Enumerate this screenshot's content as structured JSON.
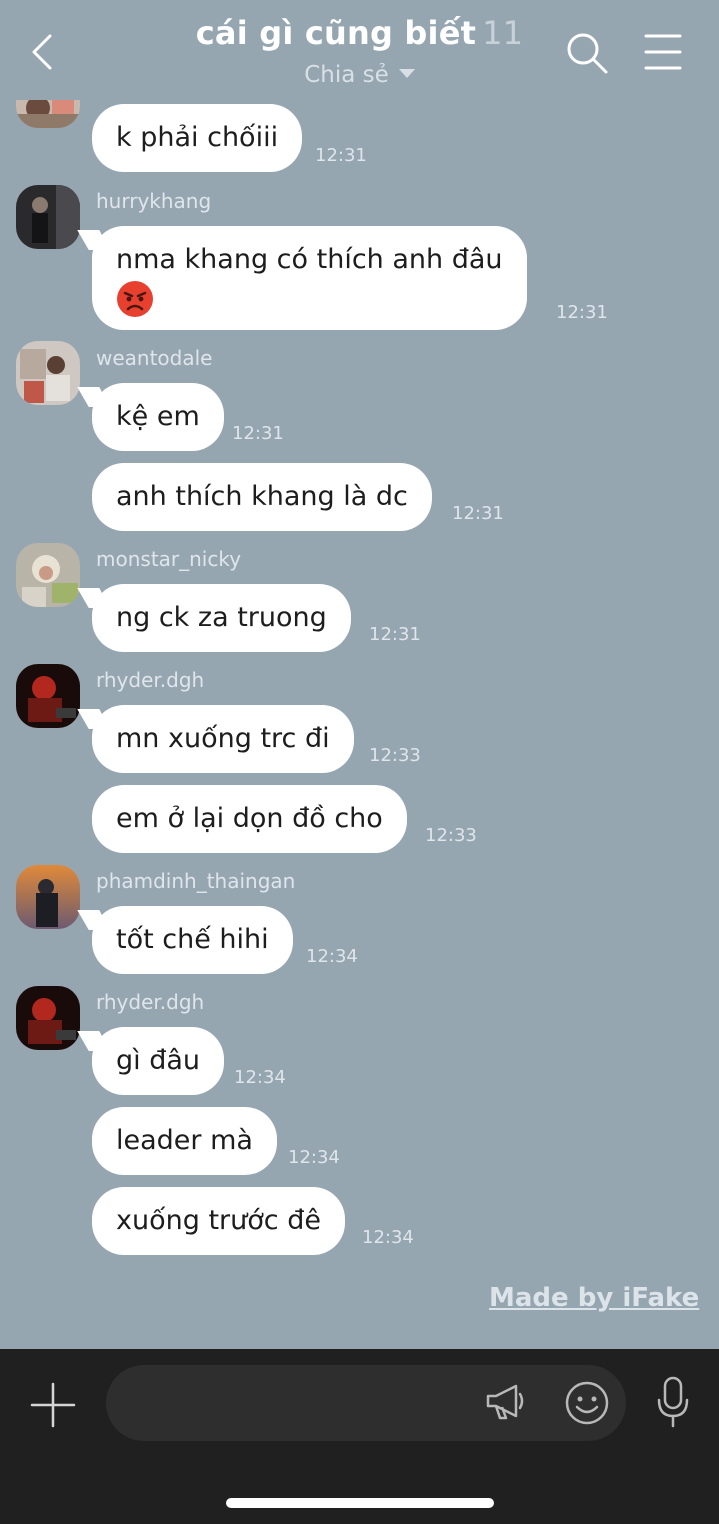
{
  "header": {
    "title": "cái gì cũng biết",
    "member_count": "11",
    "subtitle": "Chia sẻ"
  },
  "messages": [
    {
      "sender": "",
      "text": "k phải chốiii",
      "time": "12:31"
    },
    {
      "sender": "hurrykhang",
      "text": "nma khang có thích anh đâu",
      "emoji": "angry-face",
      "time": "12:31"
    },
    {
      "sender": "weantodale",
      "text": "kệ em",
      "time": "12:31"
    },
    {
      "sender": "",
      "text": "anh thích khang là dc",
      "time": "12:31"
    },
    {
      "sender": "monstar_nicky",
      "text": "ng ck za truong",
      "time": "12:31"
    },
    {
      "sender": "rhyder.dgh",
      "text": "mn xuống trc đi",
      "time": "12:33"
    },
    {
      "sender": "",
      "text": "em ở lại dọn đồ cho",
      "time": "12:33"
    },
    {
      "sender": "phamdinh_thaingan",
      "text": "tốt chế hihi",
      "time": "12:34"
    },
    {
      "sender": "rhyder.dgh",
      "text": "gì đâu",
      "time": "12:34"
    },
    {
      "sender": "",
      "text": "leader mà",
      "time": "12:34"
    },
    {
      "sender": "",
      "text": "xuống trước đê",
      "time": "12:34"
    }
  ],
  "watermark": "Made by iFake",
  "composer": {
    "placeholder": ""
  },
  "colors": {
    "chat_background": "#95a6b1",
    "bubble": "#ffffff",
    "composer_background": "#202020"
  }
}
